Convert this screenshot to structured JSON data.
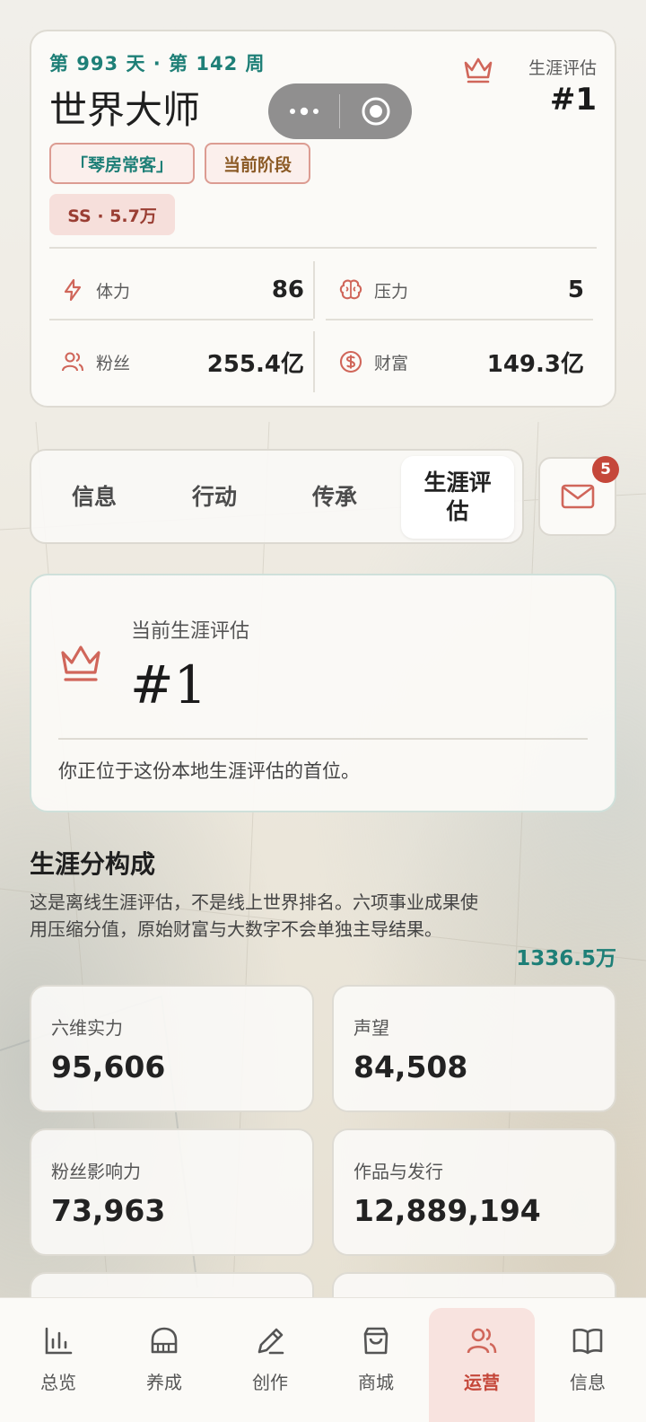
{
  "header": {
    "day_week": "第 993 天 · 第 142 周",
    "stage_title": "世界大师",
    "rank_label": "生涯评估",
    "rank_value": "#1",
    "tags": [
      "「琴房常客」",
      "当前阶段",
      "SS · 5.7万"
    ]
  },
  "stats": {
    "stamina": {
      "label": "体力",
      "value": "86",
      "icon": "lightning-icon"
    },
    "pressure": {
      "label": "压力",
      "value": "5",
      "icon": "brain-icon"
    },
    "fans": {
      "label": "粉丝",
      "value": "255.4亿",
      "icon": "users-icon"
    },
    "wealth": {
      "label": "财富",
      "value": "149.3亿",
      "icon": "dollar-coin-icon"
    }
  },
  "tabs": [
    "信息",
    "行动",
    "传承",
    "生涯评估"
  ],
  "active_tab": "生涯评估",
  "mail": {
    "badge": "5",
    "icon": "mail-icon"
  },
  "current_rank": {
    "label": "当前生涯评估",
    "value": "#1",
    "description": "你正位于这份本地生涯评估的首位。"
  },
  "composition": {
    "title": "生涯分构成",
    "description": "这是离线生涯评估，不是线上世界排名。六项事业成果使用压缩分值，原始财富与大数字不会单独主导结果。",
    "total": "1336.5万",
    "metrics": [
      {
        "label": "六维实力",
        "value": "95,606"
      },
      {
        "label": "声望",
        "value": "84,508"
      },
      {
        "label": "粉丝影响力",
        "value": "73,963"
      },
      {
        "label": "作品与发行",
        "value": "12,889,194"
      }
    ]
  },
  "bottom_nav": [
    {
      "label": "总览",
      "icon": "bar-chart-icon"
    },
    {
      "label": "养成",
      "icon": "piano-icon"
    },
    {
      "label": "创作",
      "icon": "pencil-icon"
    },
    {
      "label": "商城",
      "icon": "shopping-bag-icon"
    },
    {
      "label": "运营",
      "icon": "users-icon",
      "active": true
    },
    {
      "label": "信息",
      "icon": "book-icon"
    }
  ],
  "colors": {
    "accent_teal": "#1e7f77",
    "accent_red": "#c5473a",
    "icon_red": "#d0665a",
    "card_bg": "#fbfaf7"
  }
}
